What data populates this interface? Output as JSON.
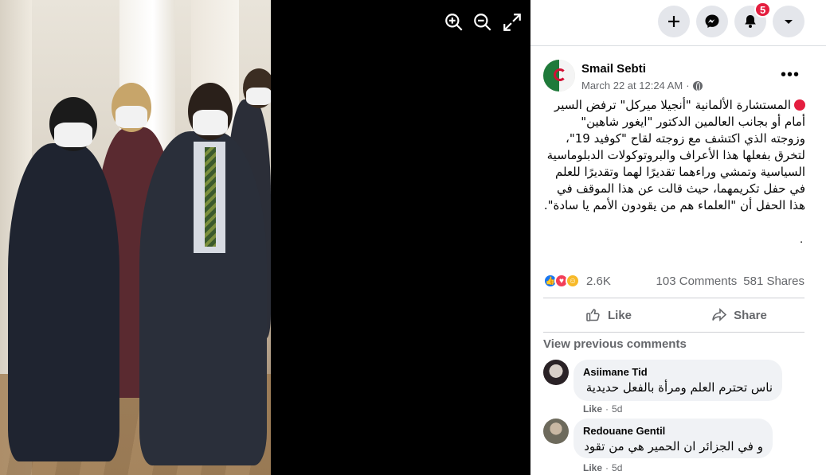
{
  "viewer": {
    "controls": {
      "zoom_in": "zoom-in-icon",
      "zoom_out": "zoom-out-icon",
      "fullscreen": "fullscreen-icon"
    }
  },
  "topbar": {
    "notification_count": "5"
  },
  "post": {
    "author": "Smail Sebti",
    "date": "March 22 at 12:24 AM",
    "separator": "·",
    "text": "المستشارة الألمانية \"أنجيلا ميركل\" ترفض السير أمام أو بجانب العالمين الدكتور \"ايغور شاهين\" وزوجته الذي اكتشف مع زوجته لقاح \"كوفيد 19\"، لتخرق بفعلها هذا الأعراف والبروتوكولات الدبلوماسية السياسية وتمشي وراءهما تقديرًا لهما وتقديرًا للعلم في حفل تكريمهما، حيث قالت عن هذا الموقف في هذا الحفل أن \"العلماء هم من يقودون الأمم يا سادة\".",
    "trailing": ".",
    "reactions_count": "2.6K",
    "comments_count": "103 Comments",
    "shares_count": "581 Shares",
    "like_label": "Like",
    "share_label": "Share"
  },
  "comments": {
    "view_previous": "View previous comments",
    "items": [
      {
        "name": "Asiimane Tid",
        "text": "ناس تحترم العلم ومرأة بالفعل حديدية",
        "like": "Like",
        "sep": "·",
        "time": "5d"
      },
      {
        "name": "Redouane Gentil",
        "text": "و في الجزائر ان الحمير هي من تقود",
        "like": "Like",
        "sep": "·",
        "time": "5d"
      }
    ]
  },
  "colors": {
    "accent": "#1877f2",
    "badge": "#e41e3f",
    "secondary_text": "#65676b"
  }
}
